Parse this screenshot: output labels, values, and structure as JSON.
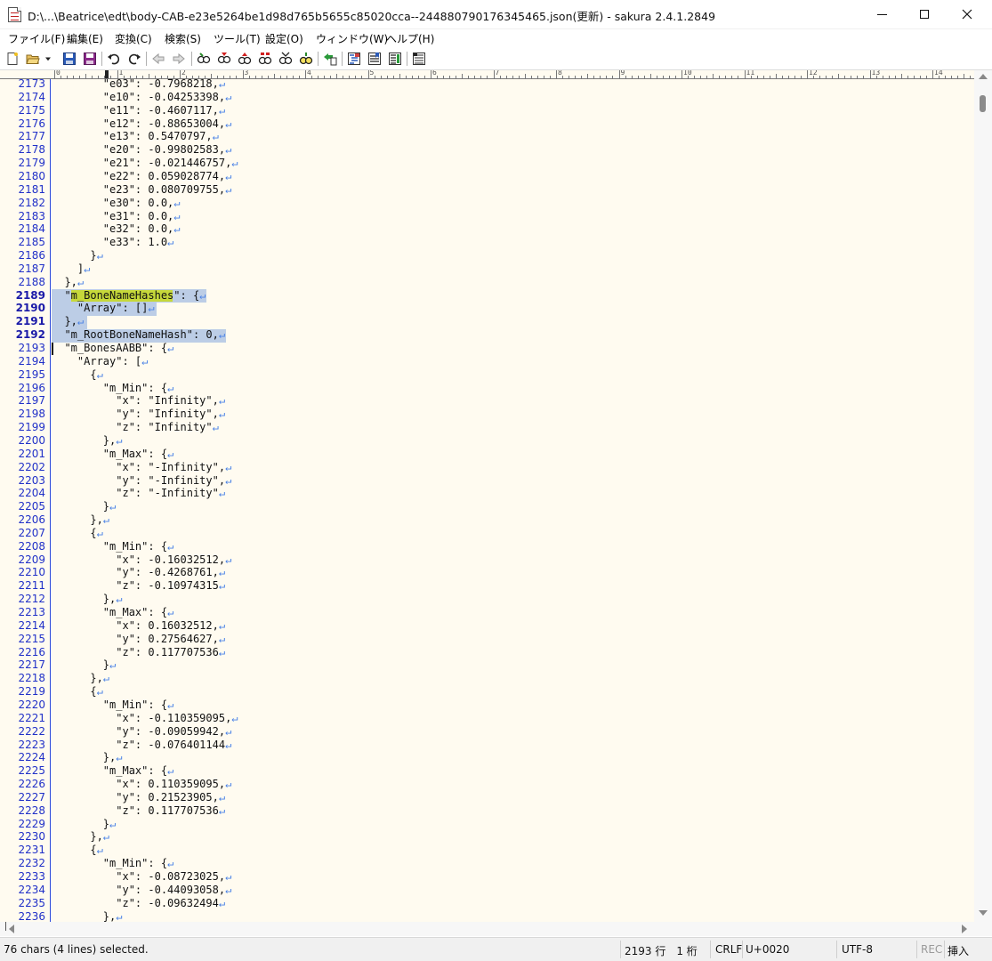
{
  "window": {
    "title": "D:\\...\\Beatrice\\edt\\body-CAB-e23e5264be1d98d765b5655c85020cca--244880790176345465.json(更新) - sakura 2.4.1.2849",
    "app_icon": "notepad-icon",
    "controls": [
      "minimize-icon",
      "maximize-icon",
      "close-icon"
    ]
  },
  "menu": {
    "items": [
      "ファイル(F)",
      "編集(E)",
      "変換(C)",
      "検索(S)",
      "ツール(T)",
      "設定(O)",
      "ウィンドウ(W)",
      "ヘルプ(H)"
    ]
  },
  "toolbar": {
    "buttons": [
      "new-file-icon",
      "open-file-icon",
      "open-dropdown-icon",
      "save-icon",
      "save-all-icon",
      "undo-icon",
      "redo-icon",
      "jump-back-icon",
      "jump-forward-icon",
      "find-icon",
      "find-prev-icon",
      "find-next-icon",
      "replace-icon",
      "find-bookmark-icon",
      "grep-icon",
      "tag-jump-icon",
      "outline-icon",
      "bookmark-list-icon",
      "function-list-icon",
      "settings-icon"
    ]
  },
  "ruler": {
    "labels": [
      "0",
      "1",
      "2",
      "3",
      "4",
      "5",
      "6",
      "7",
      "8",
      "9",
      "10",
      "11",
      "12",
      "13",
      "14"
    ]
  },
  "editor": {
    "first_line": 2173,
    "selected_lines": [
      2189,
      2190,
      2191,
      2192
    ],
    "lines": [
      "        \"e03\": -0.7968218,",
      "        \"e10\": -0.04253398,",
      "        \"e11\": -0.4607117,",
      "        \"e12\": -0.88653004,",
      "        \"e13\": 0.5470797,",
      "        \"e20\": -0.99802583,",
      "        \"e21\": -0.021446757,",
      "        \"e22\": 0.059028774,",
      "        \"e23\": 0.080709755,",
      "        \"e30\": 0.0,",
      "        \"e31\": 0.0,",
      "        \"e32\": 0.0,",
      "        \"e33\": 1.0",
      "      }",
      "    ]",
      "  },",
      "  \"m_BoneNameHashes\": {",
      "    \"Array\": []",
      "  },",
      "  \"m_RootBoneNameHash\": 0,",
      "  \"m_BonesAABB\": {",
      "    \"Array\": [",
      "      {",
      "        \"m_Min\": {",
      "          \"x\": \"Infinity\",",
      "          \"y\": \"Infinity\",",
      "          \"z\": \"Infinity\"",
      "        },",
      "        \"m_Max\": {",
      "          \"x\": \"-Infinity\",",
      "          \"y\": \"-Infinity\",",
      "          \"z\": \"-Infinity\"",
      "        }",
      "      },",
      "      {",
      "        \"m_Min\": {",
      "          \"x\": -0.16032512,",
      "          \"y\": -0.4268761,",
      "          \"z\": -0.10974315",
      "        },",
      "        \"m_Max\": {",
      "          \"x\": 0.16032512,",
      "          \"y\": 0.27564627,",
      "          \"z\": 0.117707536",
      "        }",
      "      },",
      "      {",
      "        \"m_Min\": {",
      "          \"x\": -0.110359095,",
      "          \"y\": -0.09059942,",
      "          \"z\": -0.076401144",
      "        },",
      "        \"m_Max\": {",
      "          \"x\": 0.110359095,",
      "          \"y\": 0.21523905,",
      "          \"z\": 0.117707536",
      "        }",
      "      },",
      "      {",
      "        \"m_Min\": {",
      "          \"x\": -0.08723025,",
      "          \"y\": -0.44093058,",
      "          \"z\": -0.09632494",
      "        },"
    ],
    "line_end_icon": "return-arrow-icon",
    "line_end_glyph": "↵"
  },
  "status": {
    "selection": "76 chars (4 lines) selected.",
    "position": "2193 行　1 桁",
    "line_ending": "CRLF",
    "char_code": "U+0020",
    "encoding": "UTF-8",
    "rec": "REC",
    "mode": "挿入"
  },
  "colors": {
    "editor_bg": "#fffbf0",
    "line_numbers": "#2030c8",
    "selection": "#bccde6",
    "highlight": "#c6d83a",
    "return_mark": "#4a82e6"
  }
}
